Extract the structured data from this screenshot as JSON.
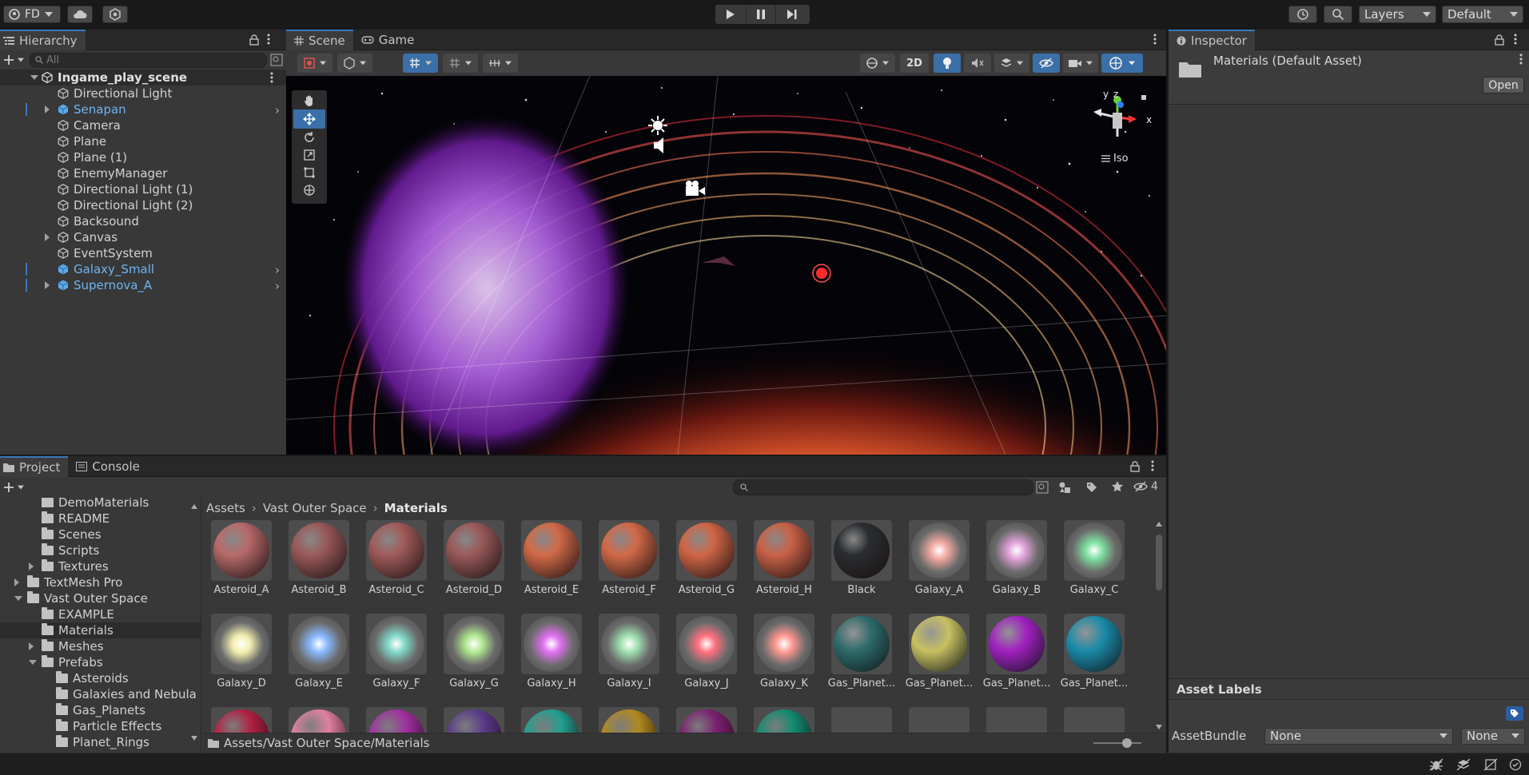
{
  "toolbar": {
    "account": "FD",
    "layers": "Layers",
    "layout": "Default"
  },
  "hierarchy": {
    "tab": "Hierarchy",
    "search_placeholder": "All",
    "scene": "Ingame_play_scene",
    "items": [
      {
        "label": "Directional Light",
        "blue": false,
        "expand": false,
        "sub": false
      },
      {
        "label": "Senapan",
        "blue": true,
        "expand": true,
        "sub": true
      },
      {
        "label": "Camera",
        "blue": false,
        "expand": false,
        "sub": false
      },
      {
        "label": "Plane",
        "blue": false,
        "expand": false,
        "sub": false
      },
      {
        "label": "Plane (1)",
        "blue": false,
        "expand": false,
        "sub": false
      },
      {
        "label": "EnemyManager",
        "blue": false,
        "expand": false,
        "sub": false
      },
      {
        "label": "Directional Light (1)",
        "blue": false,
        "expand": false,
        "sub": false
      },
      {
        "label": "Directional Light (2)",
        "blue": false,
        "expand": false,
        "sub": false
      },
      {
        "label": "Backsound",
        "blue": false,
        "expand": false,
        "sub": false
      },
      {
        "label": "Canvas",
        "blue": false,
        "expand": true,
        "sub": false
      },
      {
        "label": "EventSystem",
        "blue": false,
        "expand": false,
        "sub": false
      },
      {
        "label": "Galaxy_Small",
        "blue": true,
        "expand": false,
        "sub": true
      },
      {
        "label": "Supernova_A",
        "blue": true,
        "expand": true,
        "sub": true
      }
    ]
  },
  "scene_view": {
    "tab_scene": "Scene",
    "tab_game": "Game",
    "btn_2d": "2D",
    "gizmo_y": "y",
    "gizmo_z": "z",
    "gizmo_x": "x",
    "projection": "Iso"
  },
  "inspector": {
    "tab": "Inspector",
    "title": "Materials (Default Asset)",
    "open": "Open",
    "asset_labels": "Asset Labels",
    "asset_bundle_label": "AssetBundle",
    "bundle_value": "None",
    "variant_value": "None"
  },
  "project": {
    "tab_project": "Project",
    "tab_console": "Console",
    "hidden_count": "4",
    "breadcrumb": [
      "Assets",
      "Vast Outer Space",
      "Materials"
    ],
    "path": "Assets/Vast Outer Space/Materials",
    "tree": [
      {
        "label": "DemoMaterials",
        "indent": 2,
        "arrow": "none"
      },
      {
        "label": "README",
        "indent": 2,
        "arrow": "none"
      },
      {
        "label": "Scenes",
        "indent": 2,
        "arrow": "none"
      },
      {
        "label": "Scripts",
        "indent": 2,
        "arrow": "none"
      },
      {
        "label": "Textures",
        "indent": 2,
        "arrow": "right"
      },
      {
        "label": "TextMesh Pro",
        "indent": 1,
        "arrow": "right"
      },
      {
        "label": "Vast Outer Space",
        "indent": 1,
        "arrow": "down"
      },
      {
        "label": "EXAMPLE",
        "indent": 2,
        "arrow": "none"
      },
      {
        "label": "Materials",
        "indent": 2,
        "arrow": "none",
        "selected": true
      },
      {
        "label": "Meshes",
        "indent": 2,
        "arrow": "right"
      },
      {
        "label": "Prefabs",
        "indent": 2,
        "arrow": "down"
      },
      {
        "label": "Asteroids",
        "indent": 3,
        "arrow": "none"
      },
      {
        "label": "Galaxies and Nebula",
        "indent": 3,
        "arrow": "none"
      },
      {
        "label": "Gas_Planets",
        "indent": 3,
        "arrow": "none"
      },
      {
        "label": "Particle Effects",
        "indent": 3,
        "arrow": "none"
      },
      {
        "label": "Planet_Rings",
        "indent": 3,
        "arrow": "none"
      }
    ],
    "assets": [
      {
        "label": "Asteroid_A",
        "kind": "rock",
        "color": "#b86a6a"
      },
      {
        "label": "Asteroid_B",
        "kind": "rock",
        "color": "#9a5a5a"
      },
      {
        "label": "Asteroid_C",
        "kind": "rock",
        "color": "#a05c5a"
      },
      {
        "label": "Asteroid_D",
        "kind": "rock",
        "color": "#9a5a5a"
      },
      {
        "label": "Asteroid_E",
        "kind": "rock",
        "color": "#d26a48"
      },
      {
        "label": "Asteroid_F",
        "kind": "rock",
        "color": "#d26a48"
      },
      {
        "label": "Asteroid_G",
        "kind": "rock",
        "color": "#d06646"
      },
      {
        "label": "Asteroid_H",
        "kind": "rock",
        "color": "#c96248"
      },
      {
        "label": "Black",
        "kind": "rock",
        "color": "#2a2d30"
      },
      {
        "label": "Galaxy_A",
        "kind": "glow",
        "color": "#f0a8a0"
      },
      {
        "label": "Galaxy_B",
        "kind": "glow",
        "color": "#e0a0d8"
      },
      {
        "label": "Galaxy_C",
        "kind": "glow",
        "color": "#7ee0a0"
      },
      {
        "label": "Galaxy_D",
        "kind": "glow",
        "color": "#f4f0b0"
      },
      {
        "label": "Galaxy_E",
        "kind": "glow",
        "color": "#88b8ff"
      },
      {
        "label": "Galaxy_F",
        "kind": "glow",
        "color": "#80d8c8"
      },
      {
        "label": "Galaxy_G",
        "kind": "glow",
        "color": "#b0e890"
      },
      {
        "label": "Galaxy_H",
        "kind": "glow",
        "color": "#e070f0"
      },
      {
        "label": "Galaxy_I",
        "kind": "glow",
        "color": "#a0e0b0"
      },
      {
        "label": "Galaxy_J",
        "kind": "glow",
        "color": "#ff7080"
      },
      {
        "label": "Galaxy_K",
        "kind": "glow",
        "color": "#ff9890"
      },
      {
        "label": "Gas_Planet...",
        "kind": "planet",
        "color": "#2d6a6a"
      },
      {
        "label": "Gas_Planet...",
        "kind": "planet",
        "color": "#c8c060"
      },
      {
        "label": "Gas_Planet...",
        "kind": "planet",
        "color": "#a020c0"
      },
      {
        "label": "Gas_Planet...",
        "kind": "planet",
        "color": "#1a8aa8"
      }
    ],
    "partial_row": [
      "#b02040",
      "#e080a0",
      "#a030a0",
      "#5a3a8a",
      "#20a090",
      "#b08a20",
      "#7a2070",
      "#108a70"
    ]
  }
}
